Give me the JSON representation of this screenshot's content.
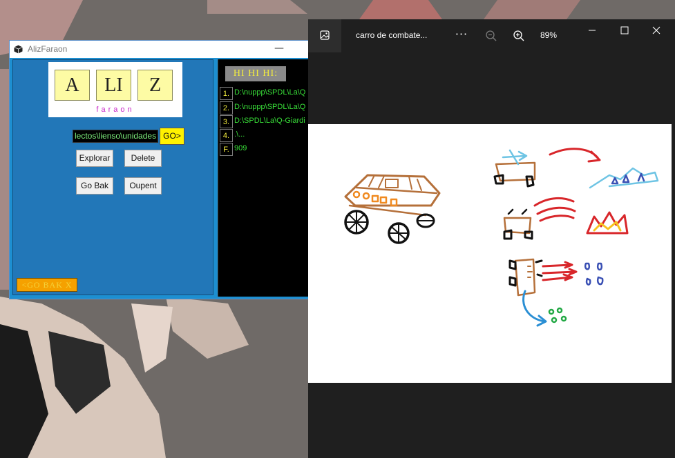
{
  "colors": {
    "aliz_blue": "#2277b8",
    "tile_yellow": "#fdfba4",
    "go_yellow": "#fff200",
    "console_green": "#39e039",
    "console_bg": "#000000",
    "gobak_orange": "#f5a100",
    "viewer_dark": "#1f1f1f"
  },
  "aliz_window": {
    "title": "AlizFaraon",
    "minimize_glyph": "—",
    "logo": {
      "tiles": [
        "A",
        "LI",
        "Z"
      ],
      "subtitle": "faraon"
    },
    "path_input_value": "lectos\\lienso\\unidades",
    "go_label": "GO>",
    "buttons": {
      "explorar": "Explorar",
      "delete": "Delete",
      "go_bak": "Go Bak",
      "oupent": "Oupent"
    },
    "gobak_orange_label": "<GO BAK X",
    "console": {
      "header": "HI HI HI:",
      "entries": [
        {
          "num": "1.",
          "text": "D:\\nuppp\\SPDL\\La\\Q"
        },
        {
          "num": "2.",
          "text": "D:\\nuppp\\SPDL\\La\\Q"
        },
        {
          "num": "3.",
          "text": "D:\\SPDL\\La\\Q-Giardi"
        },
        {
          "num": "4.",
          "text": ".\\..."
        },
        {
          "num": "F.",
          "text": "909"
        }
      ]
    }
  },
  "photo_viewer": {
    "filename": "carro de combate...",
    "more_glyph": "···",
    "zoom_level": "89%",
    "icons": [
      "image-icon",
      "zoom-out-icon",
      "zoom-in-icon",
      "minimize-icon",
      "maximize-icon",
      "close-icon"
    ]
  }
}
